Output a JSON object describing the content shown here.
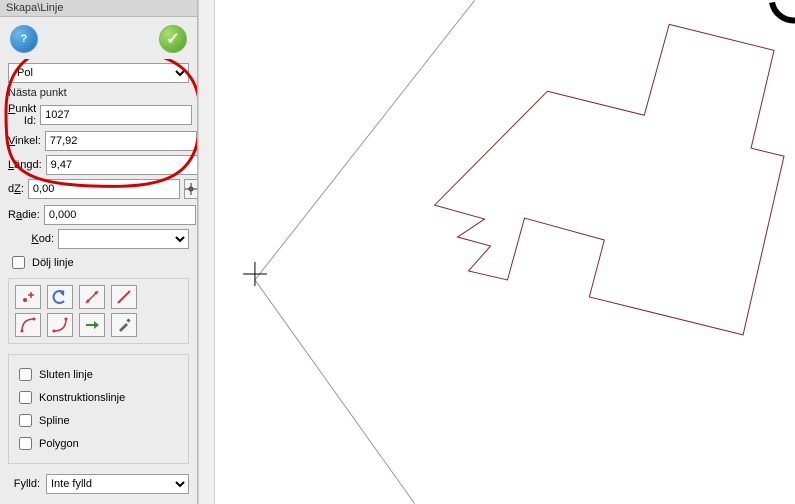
{
  "panel_title": "Skapa\\Linje",
  "help_glyph": "?",
  "ok_glyph": "✓",
  "mode_combo": "Pol",
  "section_next_point": "Nästa punkt",
  "fields": {
    "punkt_id": {
      "label": "Punkt Id:",
      "value": "1027"
    },
    "vinkel": {
      "label": "Vinkel:",
      "value": "77,92"
    },
    "langd": {
      "label": "Längd:",
      "value": "9,47"
    },
    "dz": {
      "label": "dZ:",
      "value": "0,00"
    },
    "radie": {
      "label": "Radie:",
      "value": "0,000"
    },
    "kod": {
      "label": "Kod:",
      "value": ""
    }
  },
  "hide_line_label": "Dölj linje",
  "options": {
    "sluten": "Sluten linje",
    "konstr": "Konstruktionslinje",
    "spline": "Spline",
    "polygon": "Polygon"
  },
  "fill_label": "Fylld:",
  "fill_value": "Inte fylld"
}
